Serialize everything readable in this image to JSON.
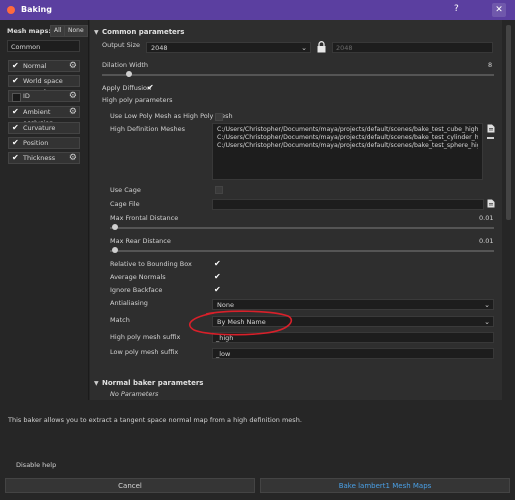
{
  "window": {
    "title": "Baking",
    "help_glyph": "?",
    "close_glyph": "✕"
  },
  "left_panel": {
    "mesh_maps_label": "Mesh maps:",
    "all_label": "All",
    "none_label": "None",
    "common_label": "Common",
    "items": [
      {
        "label": "Normal",
        "checked": true,
        "gear": true
      },
      {
        "label": "World space normal",
        "checked": true,
        "gear": false
      },
      {
        "label": "ID",
        "checked": false,
        "gear": true
      },
      {
        "label": "Ambient occlusion",
        "checked": true,
        "gear": true
      },
      {
        "label": "Curvature",
        "checked": true,
        "gear": false
      },
      {
        "label": "Position",
        "checked": true,
        "gear": false
      },
      {
        "label": "Thickness",
        "checked": true,
        "gear": true
      }
    ]
  },
  "common": {
    "title": "Common parameters",
    "output_size_label": "Output Size",
    "output_size_value": "2048",
    "output_size_value2": "2048",
    "dilation_label": "Dilation Width",
    "dilation_value": "8",
    "apply_diffusion_label": "Apply Diffusion",
    "high_poly_params_label": "High poly parameters",
    "use_low_poly_label": "Use Low Poly Mesh as High Poly Mesh",
    "hd_meshes_label": "High Definition Meshes",
    "hd_meshes": [
      "C:/Users/Christopher/Documents/maya/projects/default/scenes/bake_test_cube_high.fbx",
      "C:/Users/Christopher/Documents/maya/projects/default/scenes/bake_test_cylinder_high.fbx",
      "C:/Users/Christopher/Documents/maya/projects/default/scenes/bake_test_sphere_high.fbx"
    ],
    "use_cage_label": "Use Cage",
    "cage_file_label": "Cage File",
    "max_frontal_label": "Max Frontal Distance",
    "max_frontal_value": "0.01",
    "max_rear_label": "Max Rear Distance",
    "max_rear_value": "0.01",
    "relative_bbox_label": "Relative to Bounding Box",
    "average_normals_label": "Average Normals",
    "ignore_backface_label": "Ignore Backface",
    "antialiasing_label": "Antialiasing",
    "antialiasing_value": "None",
    "match_label": "Match",
    "match_value": "By Mesh Name",
    "high_suffix_label": "High poly mesh suffix",
    "high_suffix_value": "_high",
    "low_suffix_label": "Low poly mesh suffix",
    "low_suffix_value": "_low"
  },
  "normal_baker": {
    "title": "Normal baker parameters",
    "no_params": "No Parameters"
  },
  "help": {
    "description": "This baker allows you to extract a tangent space normal map from a high definition mesh.",
    "disable_help_label": "Disable help"
  },
  "buttons": {
    "cancel_label": "Cancel",
    "bake_label": "Bake lambert1 Mesh Maps"
  },
  "colors": {
    "titlebar": "#5b3fa0",
    "bake_text": "#4aa0e6",
    "annotation_red": "#d8202a"
  }
}
